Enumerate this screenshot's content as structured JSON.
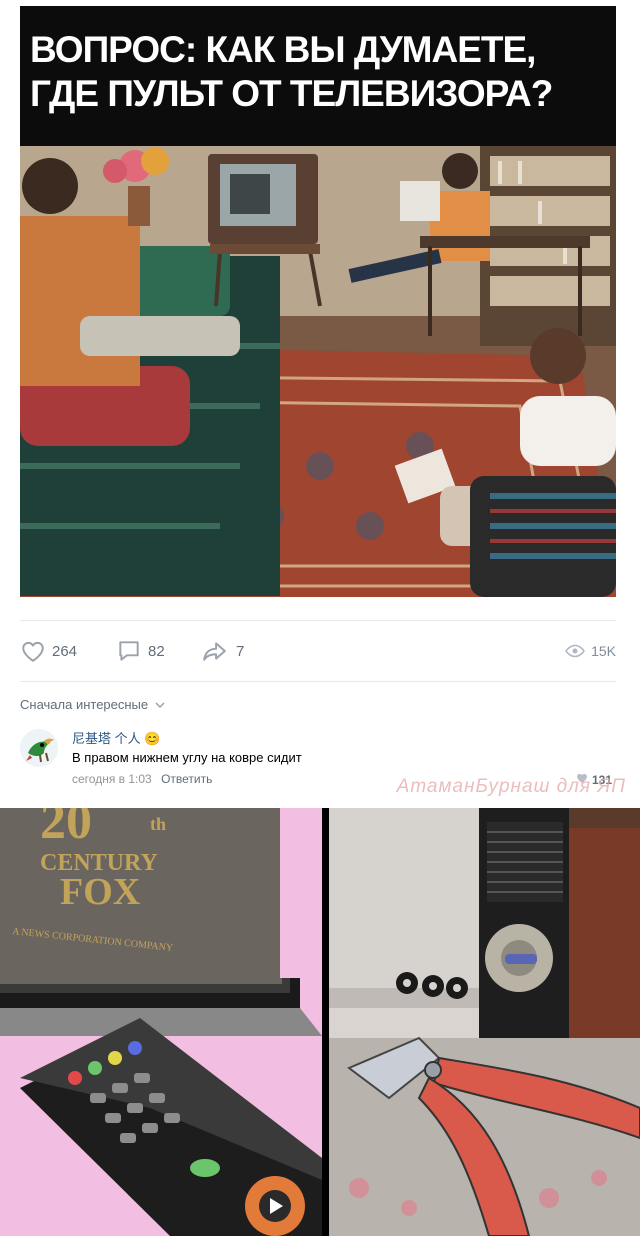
{
  "post": {
    "title_line1": "ВОПРОС: КАК ВЫ ДУМАЕТЕ,",
    "title_line2": "ГДЕ ПУЛЬТ ОТ ТЕЛЕВИЗОРА?"
  },
  "actions": {
    "likes": "264",
    "comments": "82",
    "shares": "7",
    "views": "15K"
  },
  "comments": {
    "sort_label": "Сначала интересные",
    "items": [
      {
        "author": "尼基塔 个人",
        "emoji": "😊",
        "text": "В правом нижнем углу на ковре сидит",
        "time": "сегодня в 1:03",
        "reply_label": "Ответить",
        "likes": "131"
      }
    ]
  },
  "watermark": "АтаманБурнаш для ЯП",
  "meme": {
    "left_logo_line1": "20",
    "left_logo_suffix": "th",
    "left_logo_line2": "CENTURY",
    "left_logo_line3": "FOX",
    "left_logo_line4": "A NEWS CORPORATION COMPANY"
  },
  "colors": {
    "link": "#2a5885",
    "muted": "#626d7a",
    "title_bg": "#0c0c0c"
  }
}
